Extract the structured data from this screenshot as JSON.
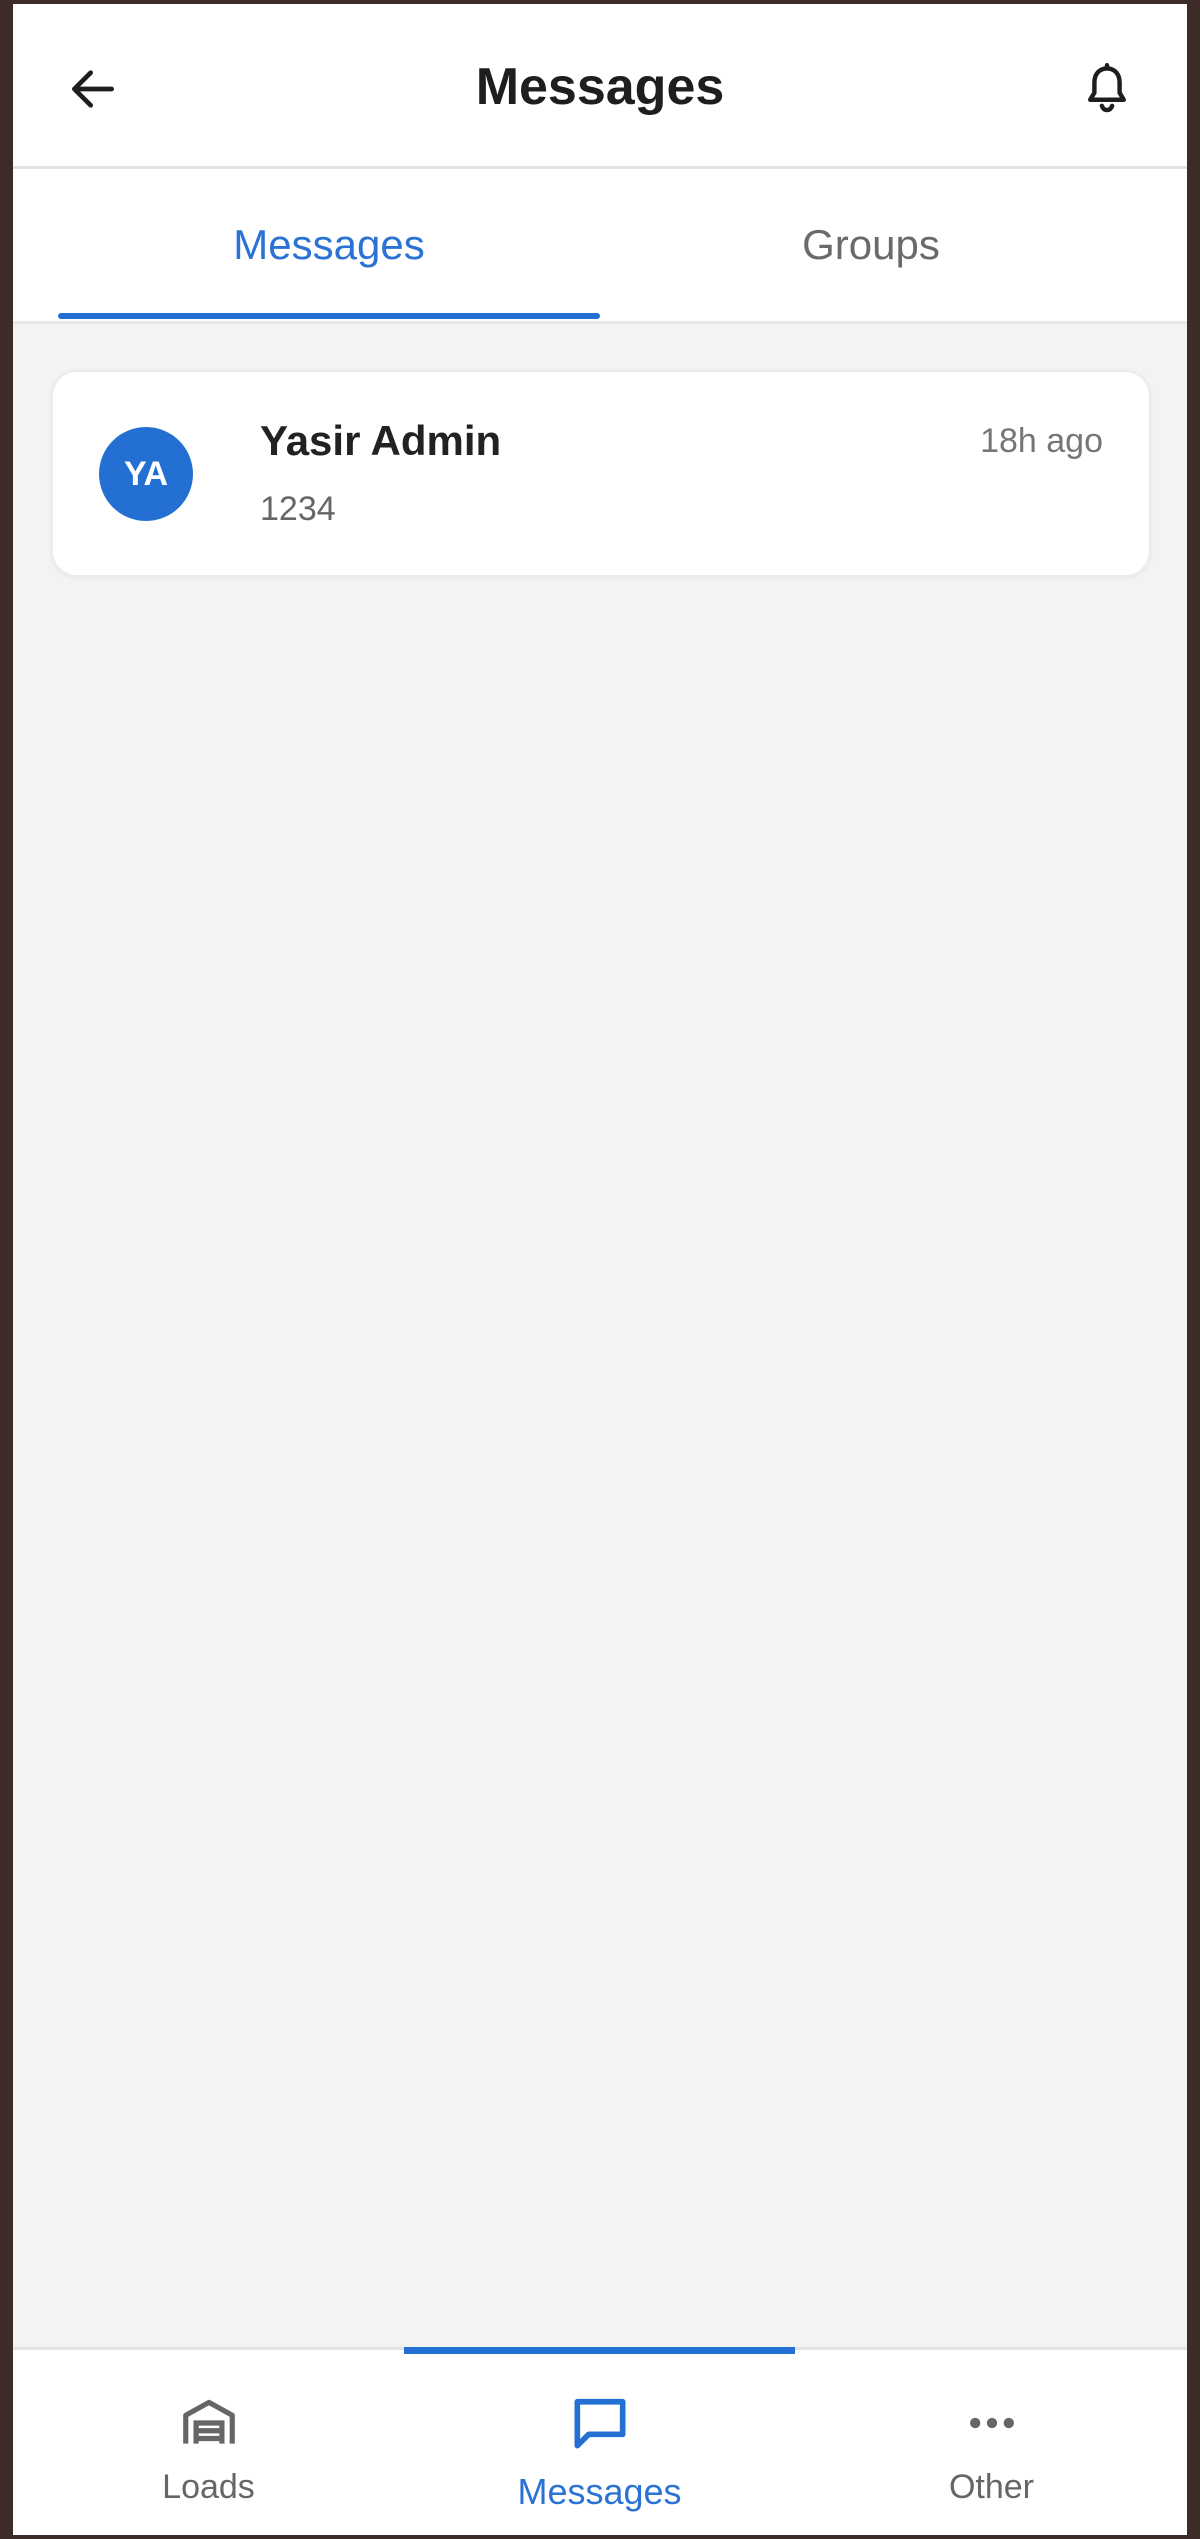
{
  "header": {
    "title": "Messages",
    "back_icon": "arrow-left-icon",
    "bell_icon": "bell-icon"
  },
  "tabs": [
    {
      "label": "Messages",
      "active": true
    },
    {
      "label": "Groups",
      "active": false
    }
  ],
  "conversations": [
    {
      "initials": "YA",
      "name": "Yasir Admin",
      "preview": "1234",
      "time": "18h ago"
    }
  ],
  "bottom_nav": [
    {
      "label": "Loads",
      "icon": "warehouse-icon",
      "active": false
    },
    {
      "label": "Messages",
      "icon": "chat-bubble-icon",
      "active": true
    },
    {
      "label": "Other",
      "icon": "more-horizontal-icon",
      "active": false
    }
  ],
  "colors": {
    "accent": "#2470d2",
    "text_primary": "#1e1e1e",
    "text_secondary": "#666666",
    "background": "#f3f3f3",
    "frame": "#3d2b28"
  }
}
